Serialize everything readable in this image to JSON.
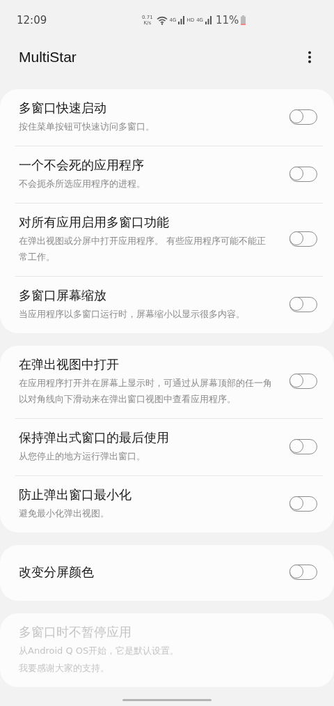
{
  "status_bar": {
    "time": "12:09",
    "speed_value": "0.71",
    "speed_unit": "K/s",
    "network_1": "4G",
    "hd": "HD",
    "network_2": "4G",
    "battery": "11%"
  },
  "app_bar": {
    "title": "MultiStar"
  },
  "groups": [
    {
      "items": [
        {
          "kind": "toggle",
          "title": "多窗口快速启动",
          "subtitle": "按住菜单按钮可快速访问多窗口。",
          "on": false,
          "disabled": false
        },
        {
          "kind": "toggle",
          "title": "一个不会死的应用程序",
          "subtitle": "不会扼杀所选应用程序的进程。",
          "on": false,
          "disabled": false
        },
        {
          "kind": "toggle",
          "title": "对所有应用启用多窗口功能",
          "subtitle": "在弹出视图或分屏中打开应用程序。 有些应用程序可能不能正常工作。",
          "on": false,
          "disabled": false
        },
        {
          "kind": "toggle",
          "title": "多窗口屏幕缩放",
          "subtitle": "当应用程序以多窗口运行时，屏幕缩小以显示很多内容。",
          "on": false,
          "disabled": false
        }
      ]
    },
    {
      "items": [
        {
          "kind": "toggle",
          "title": "在弹出视图中打开",
          "subtitle": "在应用程序打开并在屏幕上显示时，可通过从屏幕顶部的任一角以对角线向下滑动来在弹出窗口视图中查看应用程序。",
          "on": false,
          "disabled": false
        },
        {
          "kind": "toggle",
          "title": "保持弹出式窗口的最后使用",
          "subtitle": "从您停止的地方运行弹出窗口。",
          "on": false,
          "disabled": false
        },
        {
          "kind": "toggle",
          "title": "防止弹出窗口最小化",
          "subtitle": "避免最小化弹出视图。",
          "on": false,
          "disabled": false
        }
      ]
    },
    {
      "items": [
        {
          "kind": "toggle",
          "title": "改变分屏颜色",
          "on": false,
          "disabled": false
        }
      ]
    },
    {
      "items": [
        {
          "kind": "info",
          "title": "多窗口时不暂停应用",
          "notes": [
            "从Android Q OS开始，它是默认设置。",
            "我要感谢大家的支持。"
          ],
          "disabled": true
        }
      ]
    }
  ]
}
